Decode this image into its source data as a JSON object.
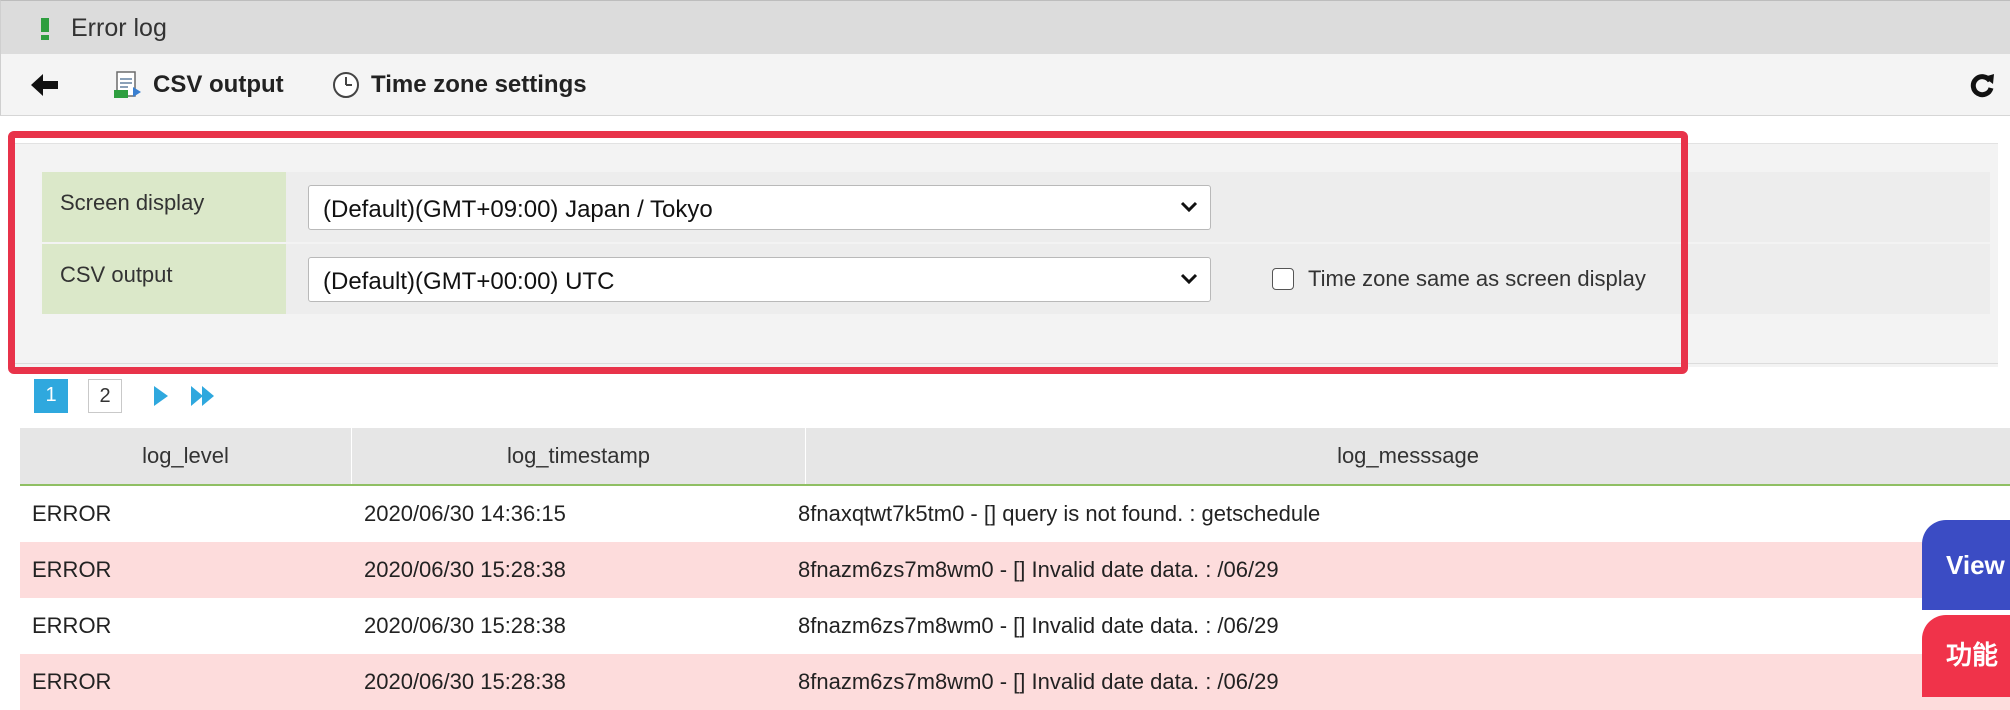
{
  "window": {
    "title": "Error log"
  },
  "toolbar": {
    "back_icon": "arrow-left-icon",
    "csv_label": "CSV output",
    "csv_icon": "csv-export-icon",
    "tz_label": "Time zone settings",
    "tz_icon": "clock-icon",
    "refresh_icon": "refresh-icon"
  },
  "tz_panel": {
    "screen_display": {
      "label": "Screen display",
      "value": "(Default)(GMT+09:00) Japan / Tokyo"
    },
    "csv_output": {
      "label": "CSV output",
      "value": "(Default)(GMT+00:00) UTC",
      "same_checkbox_label": "Time zone same as screen display",
      "same_checked": false
    }
  },
  "pagination": {
    "current": "1",
    "pages": [
      "1",
      "2"
    ]
  },
  "table": {
    "columns": [
      "log_level",
      "log_timestamp",
      "log_messsage"
    ],
    "rows": [
      [
        "ERROR",
        "2020/06/30 14:36:15",
        "8fnaxqtwt7k5tm0 - [] query is not found. : getschedule"
      ],
      [
        "ERROR",
        "2020/06/30 15:28:38",
        "8fnazm6zs7m8wm0 - [] Invalid date data. : /06/29"
      ],
      [
        "ERROR",
        "2020/06/30 15:28:38",
        "8fnazm6zs7m8wm0 - [] Invalid date data. : /06/29"
      ],
      [
        "ERROR",
        "2020/06/30 15:28:38",
        "8fnazm6zs7m8wm0 - [] Invalid date data. : /06/29"
      ]
    ]
  },
  "side_buttons": {
    "view_label": "View",
    "function_label": "功能"
  },
  "colors": {
    "highlight": "#e8334a",
    "page_active": "#2fa8de",
    "label_bg": "#dbe8c9",
    "row_alt": "#fddcdc",
    "side_view": "#3b4cc4",
    "side_function": "#f0334a"
  }
}
